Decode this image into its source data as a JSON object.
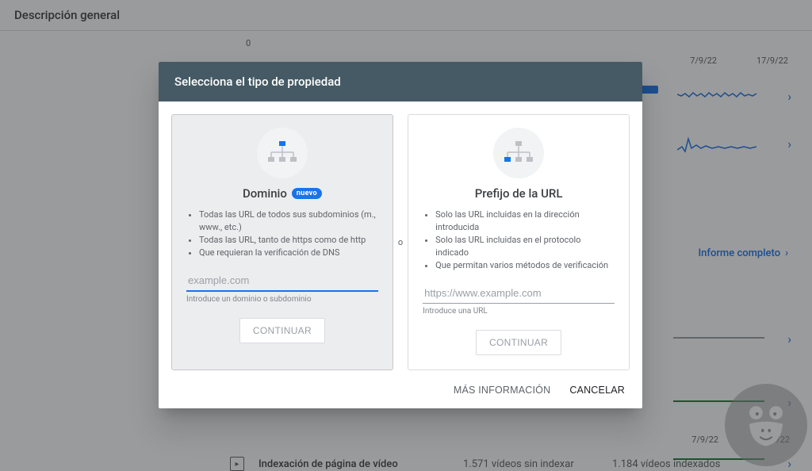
{
  "page": {
    "title": "Descripción general",
    "axis_zero": "0",
    "dates_top": [
      "7/9/22",
      "17/9/22"
    ],
    "dates_bottom": [
      "7/9/22",
      "17/9/22"
    ],
    "report_link": "Informe completo",
    "video_row": {
      "label": "Indexación de página de vídeo",
      "stat1": "1.571 vídeos sin indexar",
      "stat2": "1.184 vídeos indexados"
    }
  },
  "modal": {
    "title": "Selecciona el tipo de propiedad",
    "or": "o",
    "more": "MÁS INFORMACIÓN",
    "cancel": "CANCELAR",
    "domain_card": {
      "title": "Dominio",
      "badge": "nuevo",
      "bullets": [
        "Todas las URL de todos sus subdominios (m., www., etc.)",
        "Todas las URL, tanto de https como de http",
        "Que requieran la verificación de DNS"
      ],
      "placeholder": "example.com",
      "helper": "Introduce un dominio o subdominio",
      "continue": "CONTINUAR"
    },
    "url_card": {
      "title": "Prefijo de la URL",
      "bullets": [
        "Solo las URL incluidas en la dirección introducida",
        "Solo las URL incluidas en el protocolo indicado",
        "Que permitan varios métodos de verificación"
      ],
      "placeholder": "https://www.example.com",
      "helper": "Introduce una URL",
      "continue": "CONTINUAR"
    }
  }
}
